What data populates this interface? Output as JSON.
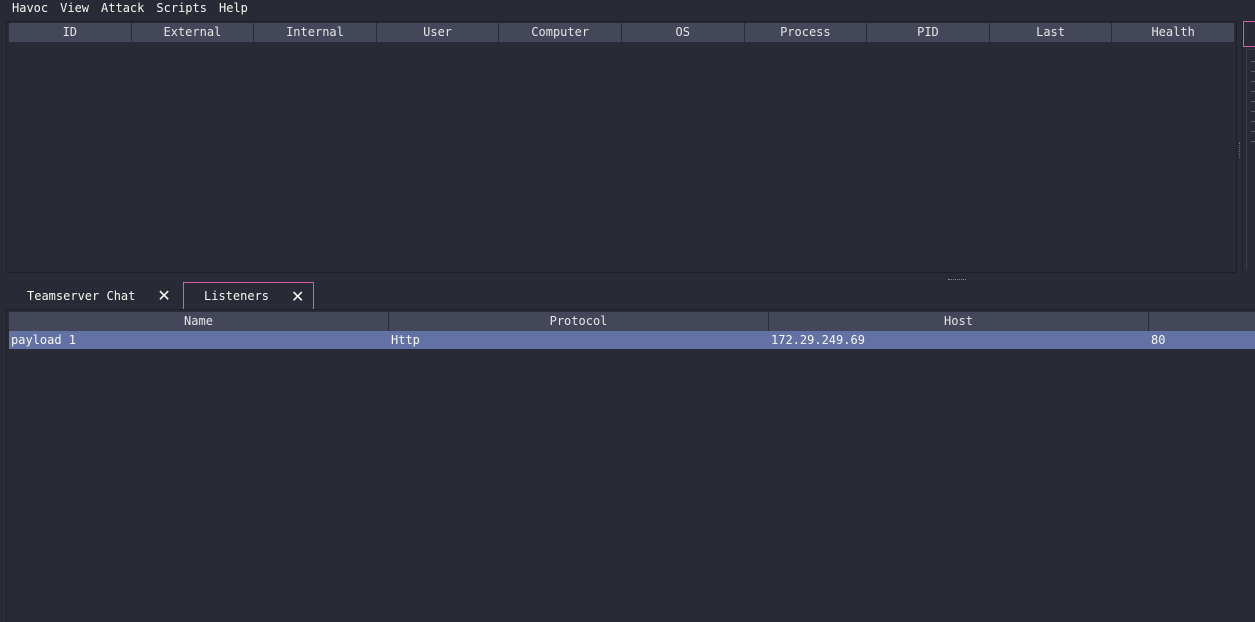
{
  "menubar": {
    "items": [
      "Havoc",
      "View",
      "Attack",
      "Scripts",
      "Help"
    ]
  },
  "sessions": {
    "columns": [
      "ID",
      "External",
      "Internal",
      "User",
      "Computer",
      "OS",
      "Process",
      "PID",
      "Last",
      "Health"
    ]
  },
  "tabs": [
    {
      "label": "Teamserver Chat",
      "active": false
    },
    {
      "label": "Listeners",
      "active": true
    }
  ],
  "listeners": {
    "columns": [
      "Name",
      "Protocol",
      "Host",
      ""
    ],
    "rows": [
      {
        "name": "payload 1",
        "protocol": "Http",
        "host": "172.29.249.69",
        "port": "80"
      }
    ]
  },
  "colors": {
    "background": "#282a36",
    "header": "#44475a",
    "selection": "#6272a4",
    "accent": "#d85fa8"
  }
}
